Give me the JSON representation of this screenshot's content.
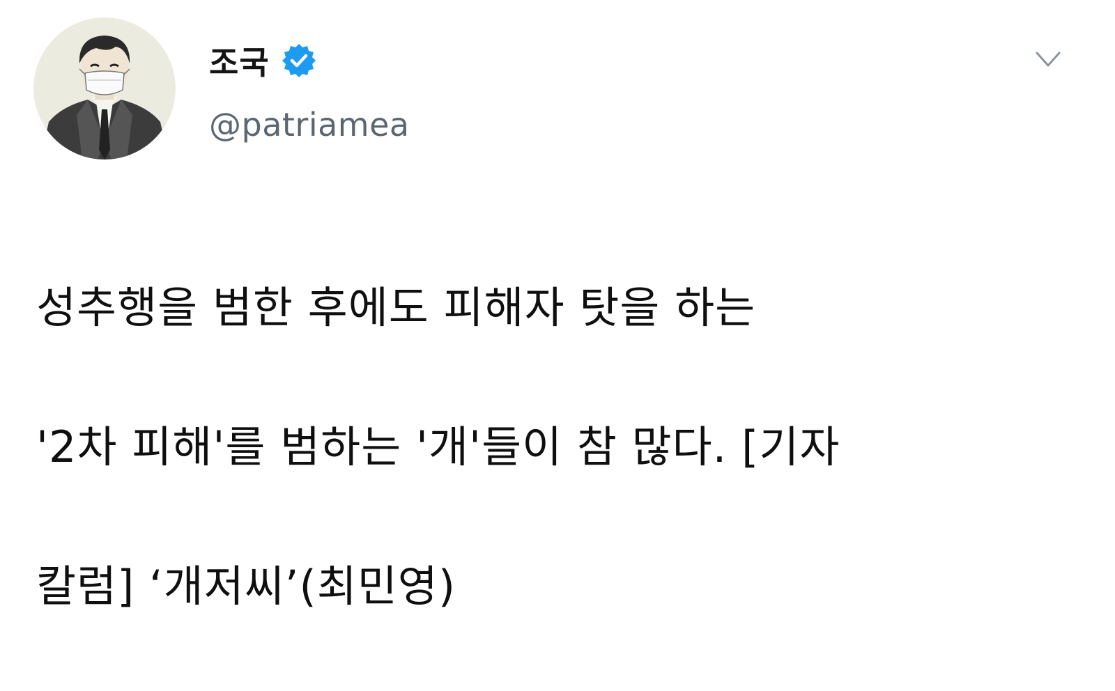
{
  "tweet": {
    "author": {
      "display_name": "조국",
      "handle": "@patriamea",
      "verified": true,
      "avatar_icon": "masked-man-in-suit-avatar",
      "verified_icon": "verified-badge-icon"
    },
    "menu_icon": "chevron-down-icon",
    "text_lines": [
      "성추행을 범한 후에도 피해자 탓을 하는",
      "'2차 피해'를 범하는 '개'들이 참 많다. [기자",
      "칼럼] ‘개저씨’(최민영)"
    ],
    "colors": {
      "verified_blue": "#1d9bf0",
      "handle_gray": "#5b6670",
      "text": "#0f0f0f"
    }
  }
}
